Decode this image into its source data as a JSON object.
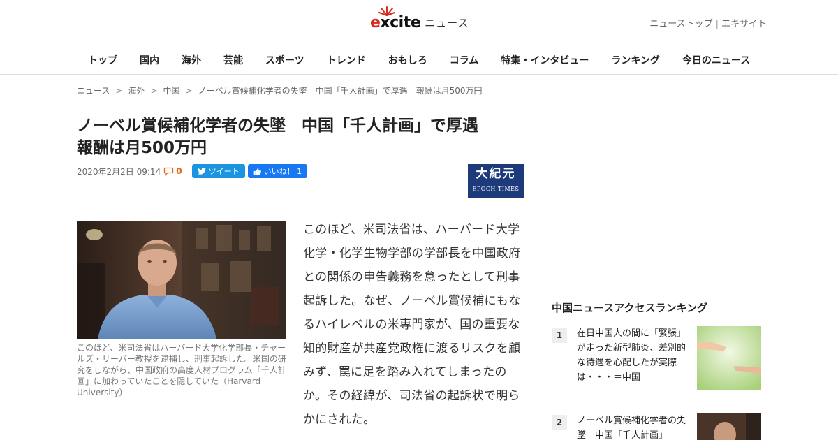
{
  "header": {
    "brand": "excite",
    "section": "ニュース",
    "top_links": [
      "ニューストップ",
      "エキサイト"
    ],
    "top_links_sep": "|"
  },
  "nav": {
    "items": [
      "トップ",
      "国内",
      "海外",
      "芸能",
      "スポーツ",
      "トレンド",
      "おもしろ",
      "コラム",
      "特集・インタビュー",
      "ランキング",
      "今日のニュース"
    ]
  },
  "breadcrumb": [
    "ニュース",
    "海外",
    "中国",
    "ノーベル賞候補化学者の失墜　中国「千人計画」で厚遇　報酬は月500万円"
  ],
  "article": {
    "title_line1": "ノーベル賞候補化学者の失墜　中国「千人計画」で厚遇",
    "title_line2": "報酬は月500万円",
    "date": "2020年2月2日 09:14",
    "comment_count": "0",
    "tweet_label": "ツイート",
    "like_label": "いいね！ 1",
    "source_logo_text": "大紀元",
    "source_logo_en": "EPOCH TIMES",
    "caption": "このほど、米司法省はハーバード大学化学部長・チャールズ・リーバー教授を逮捕し、刑事起訴した。米国の研究をしながら、中国政府の高度人材プログラム「千人計画」に加わっていたことを隠していた（Harvard University）",
    "body": "このほど、米司法省は、ハーバード大学化学・化学生物学部の学部長を中国政府との関係の申告義務を怠ったとして刑事起訴した。なぜ、ノーベル賞候補にもなるハイレベルの米専門家が、国の重要な知的財産が共産党政権に渡るリスクを顧みず、罠に足を踏み入れてしまったのか。その経緯が、司法省の起訴状で明らかにされた。"
  },
  "ranking": {
    "heading": "中国ニュースアクセスランキング",
    "items": [
      {
        "rank": "1",
        "text": "在日中国人の間に「緊張」が走った新型肺炎、差別的な待遇を心配したが実際は・・・＝中国"
      },
      {
        "rank": "2",
        "text": "ノーベル賞候補化学者の失墜　中国「千人計画」"
      }
    ]
  },
  "colors": {
    "accent_red": "#d62b1e",
    "twitter_blue": "#1b95e0",
    "facebook_blue": "#1877f2",
    "epoch_navy": "#1d3a7a",
    "comment_orange": "#e06a1b"
  }
}
